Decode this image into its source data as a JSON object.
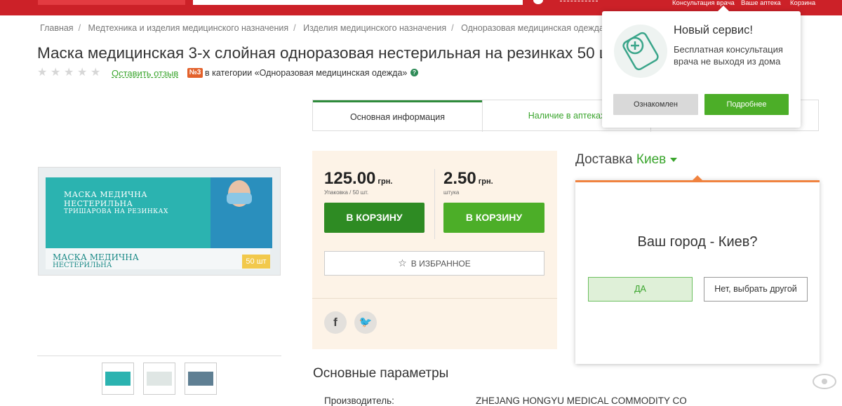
{
  "topbar": {
    "links": [
      "Консультация врача",
      "Ваше аптека",
      "Корзина"
    ]
  },
  "breadcrumb": [
    "Главная",
    "Медтехника и изделия медицинского назначения",
    "Изделия медицинского назначения",
    "Одноразовая медицинская одежда"
  ],
  "product": {
    "title": "Маска медицинская 3-х слойная одноразовая нестерильная на резинках 50 шт",
    "rating_stars": 0,
    "review_link": "Оставить отзыв",
    "rank_badge": "№3",
    "rank_text": "в категории «Одноразовая медицинская одежда»",
    "help_icon": "question-icon"
  },
  "package_image": {
    "line1": "МАСКА МЕДИЧНА",
    "line2": "НЕСТЕРИЛЬНА",
    "line3": "ТРИШАРОВА НА РЕЗИНКАХ",
    "line4": "МАСКА МЕДИЧНА",
    "line5": "НЕСТЕРИЛЬНА",
    "badge": "50 шт"
  },
  "tabs": [
    "Основная информация",
    "Наличие в аптеках",
    ""
  ],
  "pricing": {
    "pack_price": "125.00",
    "pack_currency": "грн.",
    "pack_unit": "Упаковка / 50 шт.",
    "piece_price": "2.50",
    "piece_currency": "грн.",
    "piece_unit": "штука",
    "cart_label": "В КОРЗИНУ",
    "favorite_label": "В ИЗБРАННОЕ",
    "social": [
      "facebook-icon",
      "twitter-icon"
    ]
  },
  "delivery": {
    "label": "Доставка",
    "city": "Киев"
  },
  "city_popup": {
    "question": "Ваш город - Киев?",
    "yes": "ДА",
    "other": "Нет, выбрать другой"
  },
  "service_popup": {
    "title": "Новый сервис!",
    "text": "Бесплатная консультация врача не выходя из дома",
    "ack": "Ознакомлен",
    "more": "Подробнее"
  },
  "params": {
    "title": "Основные параметры",
    "row_label": "Производитель:",
    "row_value": "ZHEJANG HONGYU MEDICAL COMMODITY CO"
  },
  "colors": {
    "brand_red": "#cc2128",
    "green": "#3aa52d",
    "dark_green": "#2e8b3b",
    "orange": "#f0823f",
    "buybox_bg": "#fdf3e7"
  }
}
